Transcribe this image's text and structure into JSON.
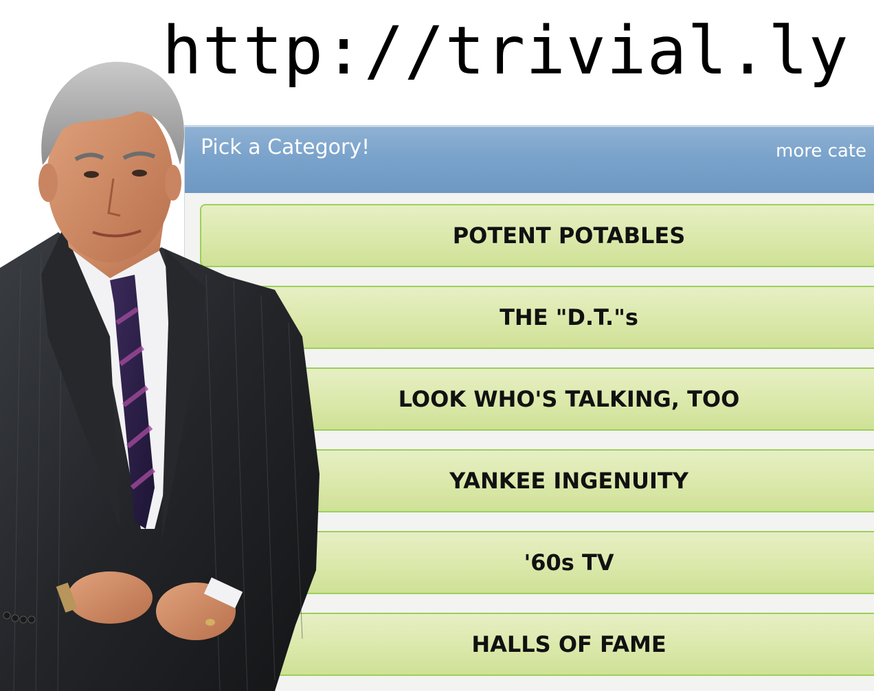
{
  "url_text": "http://trivial.ly",
  "panel": {
    "title": "Pick a Category!",
    "more_link": "more cate"
  },
  "categories": [
    {
      "label": "POTENT POTABLES"
    },
    {
      "label": "THE \"D.T.\"s"
    },
    {
      "label": "LOOK WHO'S TALKING, TOO"
    },
    {
      "label": "YANKEE INGENUITY"
    },
    {
      "label": "'60s TV"
    },
    {
      "label": "HALLS OF FAME"
    }
  ],
  "colors": {
    "header_blue": "#7aa3cb",
    "category_green": "#dce9ad",
    "category_border": "#9ccf5a",
    "url_text": "#000000"
  }
}
